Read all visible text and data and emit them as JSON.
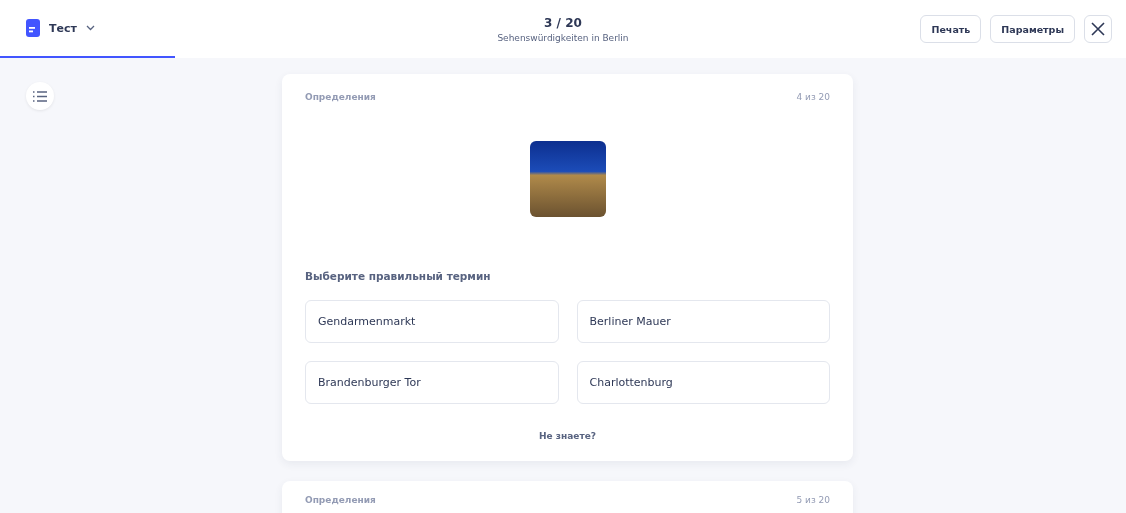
{
  "header": {
    "tab": {
      "label": "Тест",
      "selected": true
    },
    "progress": "3 / 20",
    "set_title": "Sehenswürdigkeiten in Berlin",
    "buttons": [
      "Печать",
      "Параметры"
    ]
  },
  "cards": [
    {
      "category": "Определения",
      "counter": "4 из 20",
      "has_photo": true,
      "prompt": "Выберите правильный термин",
      "options": [
        "Gendarmenmarkt",
        "Berliner Mauer",
        "Brandenburger Tor",
        "Charlottenburg"
      ],
      "skip": "Не знаете?"
    },
    {
      "category": "Определения",
      "counter": "5 из 20"
    }
  ]
}
